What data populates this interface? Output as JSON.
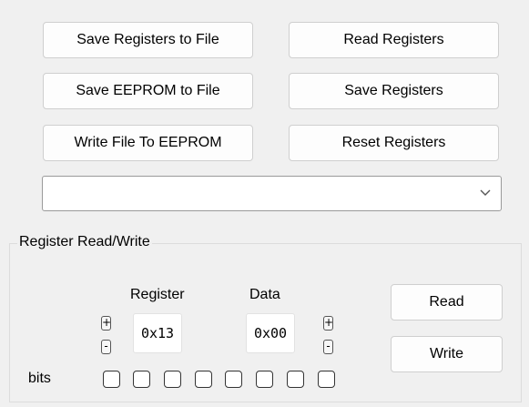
{
  "buttons": {
    "save_registers_to_file": "Save Registers to File",
    "read_registers": "Read Registers",
    "save_eeprom_to_file": "Save EEPROM to File",
    "save_registers": "Save Registers",
    "write_file_to_eeprom": "Write File To EEPROM",
    "reset_registers": "Reset Registers"
  },
  "combo": {
    "value": ""
  },
  "register_rw": {
    "legend": "Register Read/Write",
    "register_label": "Register",
    "data_label": "Data",
    "register_value": "0x13",
    "data_value": "0x00",
    "plus": "+",
    "minus": "-",
    "read_label": "Read",
    "write_label": "Write",
    "bits_label": "bits",
    "bits": [
      false,
      false,
      false,
      false,
      false,
      false,
      false,
      false
    ]
  },
  "icons": {
    "dropdown": "chevron-down-icon"
  }
}
